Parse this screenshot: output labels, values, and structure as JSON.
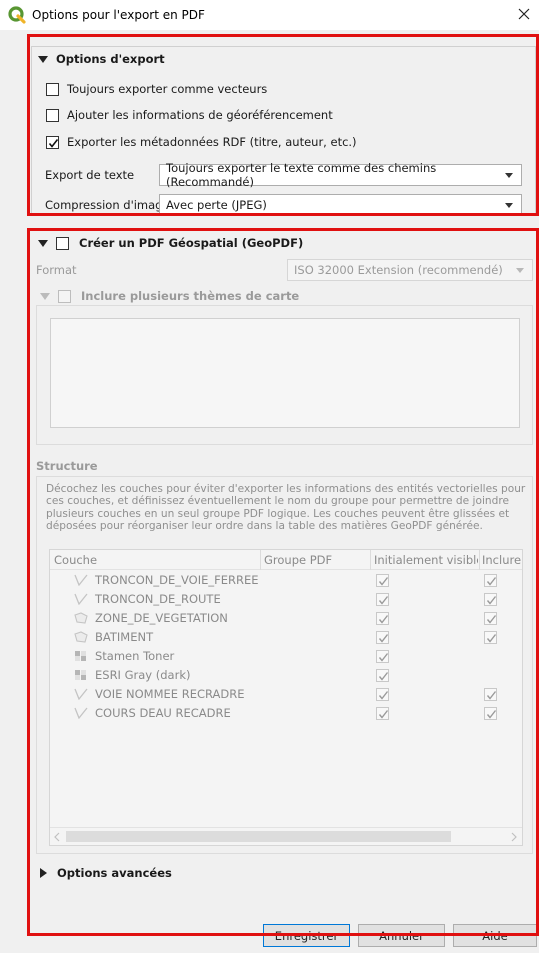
{
  "window": {
    "title": "Options pour l'export en PDF"
  },
  "export_options": {
    "title": "Options d'export",
    "vectors_label": "Toujours exporter comme vecteurs",
    "vectors_checked": false,
    "georef_label": "Ajouter les informations de géoréférencement",
    "georef_checked": false,
    "rdf_label": "Exporter les métadonnées RDF (titre, auteur, etc.)",
    "rdf_checked": true,
    "text_export_label": "Export de texte",
    "text_export_value": "Toujours exporter le texte comme des chemins (Recommandé)",
    "compression_label": "Compression d'image",
    "compression_value": "Avec perte (JPEG)"
  },
  "geopdf": {
    "title": "Créer un PDF Géospatial (GeoPDF)",
    "checked": false,
    "format_label": "Format",
    "format_value": "ISO 32000 Extension (recommendé)",
    "themes_label": "Inclure plusieurs thèmes de carte",
    "structure_label": "Structure",
    "structure_desc": "Décochez les couches pour éviter d'exporter les informations des entités vectorielles pour ces couches, et définissez éventuellement le nom du groupe pour permettre de joindre plusieurs couches en un seul groupe PDF logique. Les couches peuvent être glissées et déposées pour réorganiser leur ordre dans la table des matières GeoPDF générée.",
    "columns": [
      "Couche",
      "Groupe PDF",
      "Initialement visible",
      "Inclure"
    ],
    "layers": [
      {
        "name": "TRONCON_DE_VOIE_FERREE",
        "icon": "line-layer-icon",
        "visible": true,
        "include": true
      },
      {
        "name": "TRONCON_DE_ROUTE",
        "icon": "line-layer-icon",
        "visible": true,
        "include": true
      },
      {
        "name": "ZONE_DE_VEGETATION",
        "icon": "polygon-layer-icon",
        "visible": true,
        "include": true
      },
      {
        "name": "BATIMENT",
        "icon": "polygon-layer-icon",
        "visible": true,
        "include": true
      },
      {
        "name": "Stamen Toner",
        "icon": "raster-layer-icon",
        "visible": true,
        "include": false
      },
      {
        "name": "ESRI Gray (dark)",
        "icon": "raster-layer-icon",
        "visible": true,
        "include": false
      },
      {
        "name": "VOIE NOMMEE RECRADRE",
        "icon": "line-layer-icon",
        "visible": true,
        "include": true
      },
      {
        "name": "COURS DEAU RECADRE",
        "icon": "line-layer-icon",
        "visible": true,
        "include": true
      }
    ]
  },
  "advanced": {
    "title": "Options avancées"
  },
  "buttons": {
    "save": "Enregistrer",
    "cancel": "Annuler",
    "help": "Aide"
  },
  "colors": {
    "highlight_border": "#e01010",
    "qgis_green": "#589632"
  }
}
